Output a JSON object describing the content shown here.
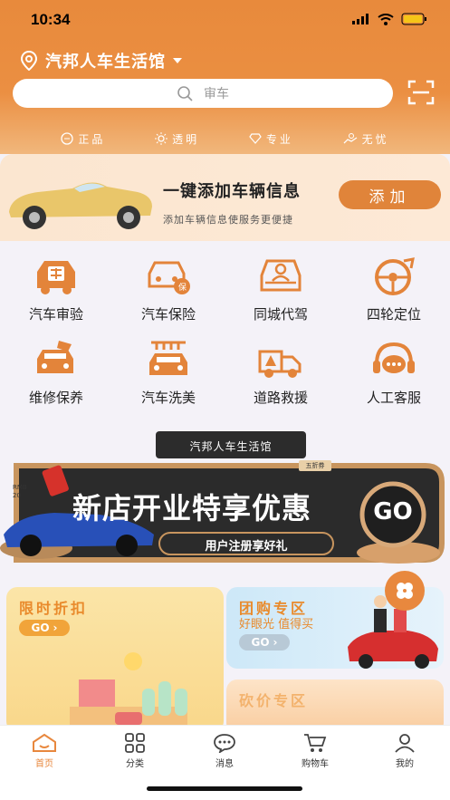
{
  "status": {
    "time": "10:34"
  },
  "location": {
    "name": "汽邦人车生活馆"
  },
  "search": {
    "placeholder": "审车"
  },
  "features": [
    {
      "icon": "shield-icon",
      "label": "正品"
    },
    {
      "icon": "sun-icon",
      "label": "透明"
    },
    {
      "icon": "diamond-icon",
      "label": "专业"
    },
    {
      "icon": "hands-icon",
      "label": "无忧"
    }
  ],
  "add_vehicle": {
    "title": "一键添加车辆信息",
    "subtitle": "添加车辆信息使服务更便捷",
    "button": "添加"
  },
  "services": [
    {
      "label": "汽车审验",
      "icon": "inspection-icon"
    },
    {
      "label": "汽车保险",
      "icon": "insurance-icon"
    },
    {
      "label": "同城代驾",
      "icon": "driver-icon"
    },
    {
      "label": "四轮定位",
      "icon": "wheel-alignment-icon"
    },
    {
      "label": "维修保养",
      "icon": "repair-icon"
    },
    {
      "label": "汽车洗美",
      "icon": "car-wash-icon"
    },
    {
      "label": "道路救援",
      "icon": "rescue-truck-icon"
    },
    {
      "label": "人工客服",
      "icon": "headset-icon"
    }
  ],
  "banner": {
    "store": "汽邦人车生活馆",
    "title": "新店开业特享优惠",
    "cta": "用户注册享好礼",
    "go": "GO",
    "coupon": "RMB 20",
    "tag": "五折券"
  },
  "promos": {
    "flash": {
      "title": "限时折扣",
      "go": "GO"
    },
    "group": {
      "title": "团购专区",
      "subtitle": "好眼光 值得买",
      "go": "GO"
    },
    "bargain": {
      "title": "砍价专区"
    }
  },
  "tabs": [
    {
      "label": "首页",
      "icon": "home-icon",
      "active": true
    },
    {
      "label": "分类",
      "icon": "category-icon"
    },
    {
      "label": "消息",
      "icon": "message-icon"
    },
    {
      "label": "购物车",
      "icon": "cart-icon"
    },
    {
      "label": "我的",
      "icon": "user-icon"
    }
  ],
  "colors": {
    "accent": "#e8883e",
    "text": "#333333"
  }
}
